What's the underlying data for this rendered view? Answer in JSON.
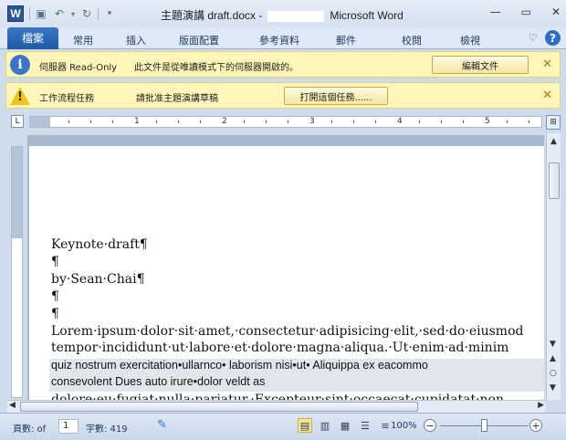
{
  "titlebar": {
    "app_icon_letter": "W",
    "document_title": "主題演講 draft.docx -",
    "app_name": "Microsoft Word",
    "minimize": "—",
    "restore": "▭",
    "close": "✕"
  },
  "ribbon": {
    "file_tab": "檔案",
    "tabs": [
      "常用",
      "插入",
      "版面配置",
      "參考資料",
      "郵件",
      "校閱",
      "檢視"
    ],
    "collapse_glyph": "♡",
    "help_glyph": "?"
  },
  "message_bar_1": {
    "icon": "info-icon",
    "label": "伺服器 Read-Only",
    "text": "此文件是從唯讀模式下的伺服器開啟的。",
    "button": "編輯文件",
    "close": "✕"
  },
  "message_bar_2": {
    "icon": "warning-icon",
    "label": "工作流程任務",
    "text": "請批准主題演講草稿",
    "button": "打開這個任務......",
    "close": "✕"
  },
  "ruler": {
    "numbers": [
      "1",
      "2",
      "3",
      "4",
      "5"
    ]
  },
  "document": {
    "lines": [
      "Keynote·draft¶",
      "¶",
      "by·Sean·Chai¶",
      "¶",
      "¶",
      "Lorem·ipsum·dolor·sit·amet,·consectetur·adipisicing·elit,·sed·do·eiusmod",
      "tempor·incididunt·ut·labore·et·dolore·magna·aliqua.·Ut·enim·ad·minim"
    ],
    "selected_lines": [
      "quiz nostrum exercitation•ullarnco• laborism nisi•ut• Aliquippa ex eacommo",
      "consevolent Dues auto irure•dolor veldt as"
    ],
    "cut_line": "dolore·eu·fugiat·nulla·pariatur.·Excepteur·sint·occaecat·cupidatat·non"
  },
  "statusbar": {
    "page_label": "頁數: of",
    "page_value": "1",
    "words_label": "字數: 419",
    "zoom": "100%",
    "zoom_level_percent": 100
  },
  "colors": {
    "accent": "#2b5797",
    "message_bar": "#fff6b9"
  }
}
